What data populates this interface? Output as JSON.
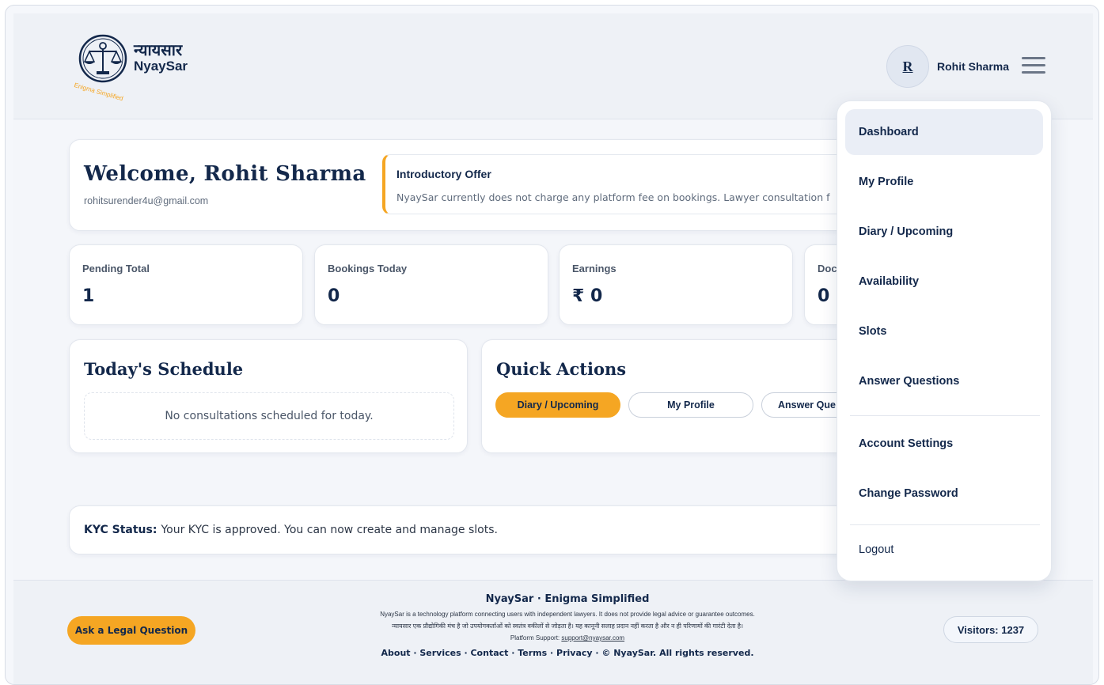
{
  "header": {
    "logo_hindi": "न्यायसार",
    "logo_english": "NyaySar",
    "logo_tagline": "Enigma Simplified",
    "avatar_initial": "R",
    "user_name": "Rohit Sharma"
  },
  "welcome": {
    "title": "Welcome, Rohit Sharma",
    "email": "rohitsurender4u@gmail.com",
    "offer_title": "Introductory Offer",
    "offer_text": "NyaySar currently does not charge any platform fee on bookings. Lawyer consultation f"
  },
  "stats": [
    {
      "label": "Pending Total",
      "value": "1"
    },
    {
      "label": "Bookings Today",
      "value": "0"
    },
    {
      "label": "Earnings",
      "value": "₹ 0"
    },
    {
      "label": "Doc",
      "value": "0"
    }
  ],
  "schedule": {
    "title": "Today's Schedule",
    "empty_text": "No consultations scheduled for today."
  },
  "quick_actions": {
    "title": "Quick Actions",
    "buttons": [
      "Diary / Upcoming",
      "My Profile",
      "Answer Que"
    ]
  },
  "kyc": {
    "label": "KYC Status:",
    "text": "Your KYC is approved. You can now create and manage slots."
  },
  "footer": {
    "ask_button": "Ask a Legal Question",
    "brand": "NyaySar · Enigma Simplified",
    "disclaimer_en": "NyaySar is a technology platform connecting users with independent lawyers. It does not provide legal advice or guarantee outcomes.",
    "disclaimer_hi": "न्यायसार एक प्रौद्योगिकी मंच है जो उपयोगकर्ताओं को स्वतंत्र वकीलों से जोड़ता है। यह कानूनी सलाह प्रदान नहीं करता है और न ही परिणामों की गारंटी देता है।",
    "support_prefix": "Platform Support:",
    "support_email": "support@nyaysar.com",
    "links": "About · Services · Contact · Terms · Privacy · © NyaySar. All rights reserved.",
    "visitors": "Visitors: 1237"
  },
  "menu": {
    "items": [
      "Dashboard",
      "My Profile",
      "Diary / Upcoming",
      "Availability",
      "Slots",
      "Answer Questions"
    ],
    "account_items": [
      "Account Settings",
      "Change Password"
    ],
    "logout": "Logout",
    "active": "Dashboard"
  },
  "colors": {
    "brand_navy": "#13284b",
    "accent_orange": "#f5a623",
    "page_bg": "#f4f6fa"
  }
}
